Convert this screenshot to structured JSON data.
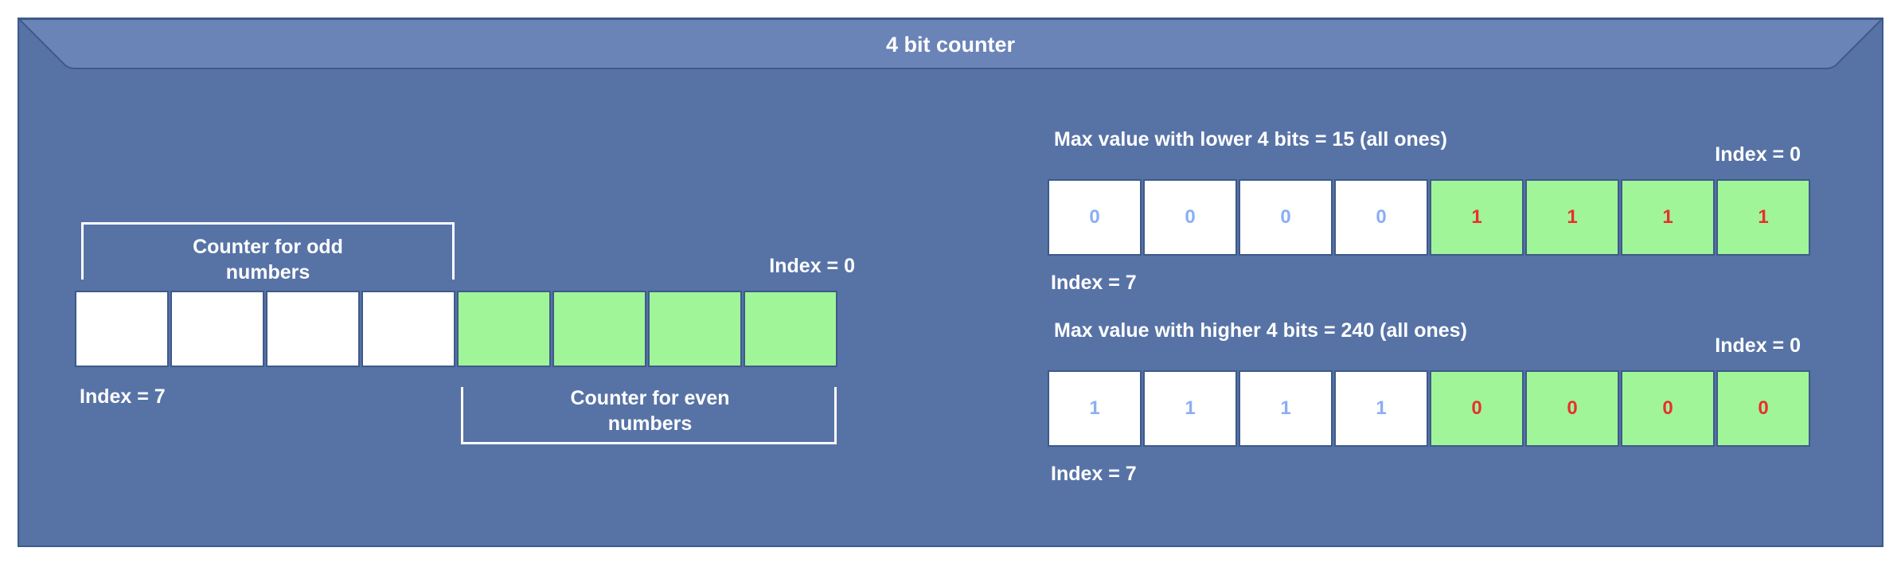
{
  "title": "4 bit counter",
  "colors": {
    "background": "#5773a6",
    "title_bar": "#6a84b8",
    "cell_white": "#ffffff",
    "cell_green": "#a0f598",
    "digit_blue": "#8aaef5",
    "digit_red": "#e8302e"
  },
  "left": {
    "odd_counter_label": "Counter for odd numbers",
    "even_counter_label": "Counter for even numbers",
    "index_high": "Index = 7",
    "index_low": "Index = 0"
  },
  "right_top": {
    "heading": "Max value with lower 4 bits = 15 (all ones)",
    "index_low": "Index = 0",
    "index_high": "Index = 7",
    "bits": [
      "0",
      "0",
      "0",
      "0",
      "1",
      "1",
      "1",
      "1"
    ]
  },
  "right_bottom": {
    "heading": "Max value with higher 4 bits = 240 (all ones)",
    "index_low": "Index = 0",
    "index_high": "Index = 7",
    "bits": [
      "1",
      "1",
      "1",
      "1",
      "0",
      "0",
      "0",
      "0"
    ]
  }
}
